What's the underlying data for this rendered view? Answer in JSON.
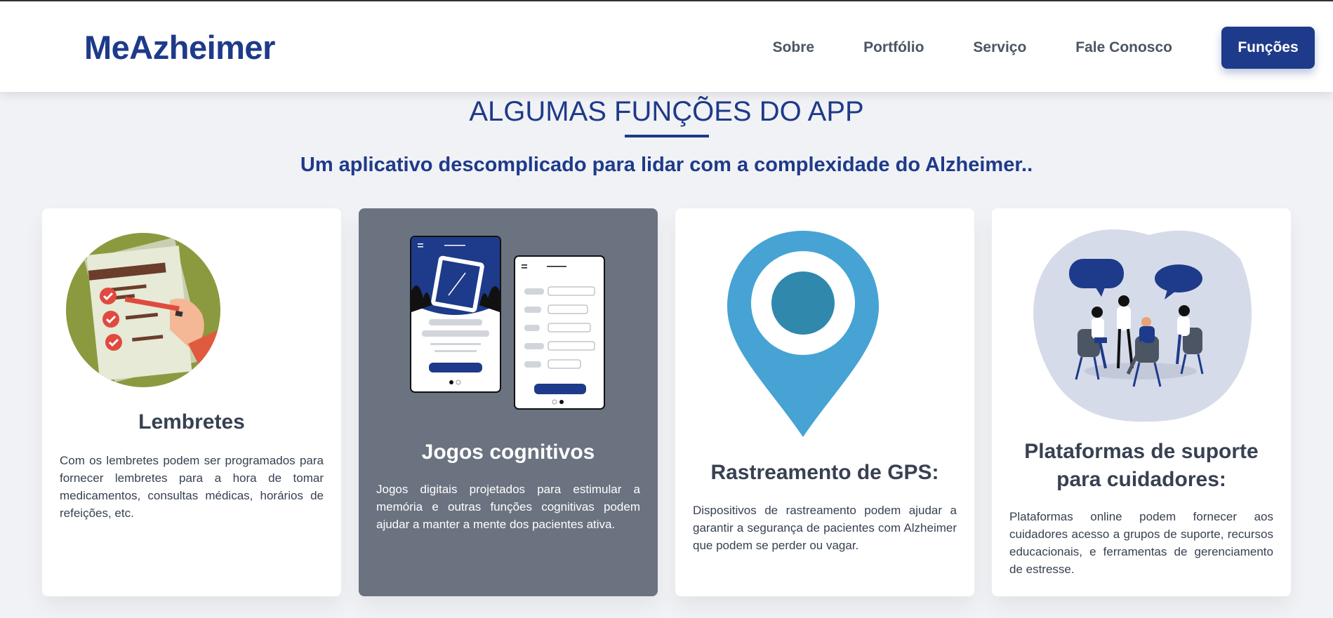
{
  "header": {
    "logo": "MeAzheimer",
    "nav": [
      "Sobre",
      "Portfólio",
      "Serviço",
      "Fale Conosco"
    ],
    "cta": "Funções"
  },
  "section": {
    "title": "ALGUMAS FUNÇÕES DO APP",
    "subtitle": "Um aplicativo descomplicado para lidar com a complexidade do Alzheimer.."
  },
  "cards": [
    {
      "title": "Lembretes",
      "text": "Com os lembretes podem ser programados para fornecer lembretes para a hora de tomar medicamentos, consultas médicas, horários de refeições, etc.",
      "icon": "checklist-icon"
    },
    {
      "title": "Jogos cognitivos",
      "text": "Jogos digitais projetados para estimular a memória e outras funções cognitivas podem ajudar a manter a mente dos pacientes ativa.",
      "icon": "phone-app-icon"
    },
    {
      "title": "Rastreamento de GPS:",
      "text": "Dispositivos de rastreamento podem ajudar a garantir a segurança de pacientes com Alzheimer que podem se perder ou vagar.",
      "icon": "location-pin-icon"
    },
    {
      "title": "Plataformas de suporte para cuidadores:",
      "text": "Plataformas online podem fornecer aos cuidadores acesso a grupos de suporte, recursos educacionais, e ferramentas de gerenciamento de estresse.",
      "icon": "support-group-icon"
    }
  ],
  "colors": {
    "brand": "#1e3a8a",
    "page_bg": "#f1f2f5",
    "dark_card": "#6b7280",
    "pin": "#4aa3d4"
  }
}
